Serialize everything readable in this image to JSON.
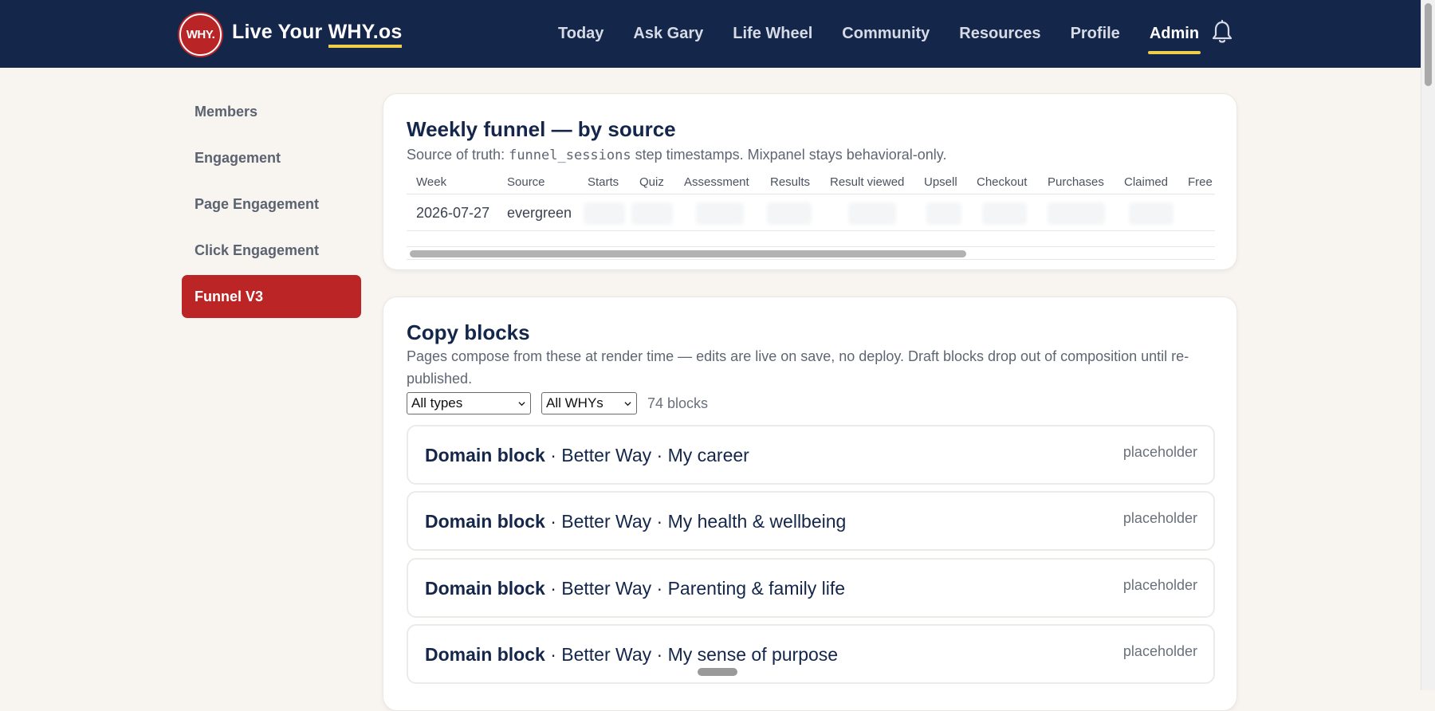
{
  "brand": {
    "logo_text": "WHY.",
    "name_prefix": "Live Your ",
    "name_highlight": "WHY.os"
  },
  "nav": {
    "items": [
      {
        "label": "Today",
        "active": false
      },
      {
        "label": "Ask Gary",
        "active": false
      },
      {
        "label": "Life Wheel",
        "active": false
      },
      {
        "label": "Community",
        "active": false
      },
      {
        "label": "Resources",
        "active": false
      },
      {
        "label": "Profile",
        "active": false
      },
      {
        "label": "Admin",
        "active": true
      }
    ],
    "bell_icon": "bell-icon"
  },
  "sidebar": {
    "items": [
      {
        "label": "Members",
        "active": false
      },
      {
        "label": "Engagement",
        "active": false
      },
      {
        "label": "Page Engagement",
        "active": false
      },
      {
        "label": "Click Engagement",
        "active": false
      },
      {
        "label": "Funnel V3",
        "active": true
      }
    ]
  },
  "funnel": {
    "title": "Weekly funnel — by source",
    "subtitle_prefix": "Source of truth: ",
    "subtitle_code": "funnel_sessions",
    "subtitle_suffix": " step timestamps. Mixpanel stays behavioral-only.",
    "columns": [
      "Week",
      "Source",
      "Starts",
      "Quiz",
      "Assessment",
      "Results",
      "Result viewed",
      "Upsell",
      "Checkout",
      "Purchases",
      "Claimed",
      "Free"
    ],
    "rows": [
      {
        "week": "2026-07-27",
        "source": "evergreen"
      }
    ]
  },
  "copy_blocks": {
    "title": "Copy blocks",
    "subtitle": "Pages compose from these at render time — edits are live on save, no deploy. Draft blocks drop out of composition until re-published.",
    "type_filter": "All types",
    "why_filter": "All WHYs",
    "count_text": "74 blocks",
    "blocks": [
      {
        "kind": "Domain block",
        "meta": " · Better Way · My career",
        "status": "placeholder"
      },
      {
        "kind": "Domain block",
        "meta": " · Better Way · My health & wellbeing",
        "status": "placeholder"
      },
      {
        "kind": "Domain block",
        "meta": " · Better Way · Parenting & family life",
        "status": "placeholder"
      },
      {
        "kind": "Domain block",
        "meta": " · Better Way · My sense of purpose",
        "status": "placeholder"
      }
    ]
  },
  "colors": {
    "navy": "#14264a",
    "accent_red": "#bb2526",
    "accent_yellow": "#efcf4a",
    "page_bg": "#f8f5f1"
  }
}
